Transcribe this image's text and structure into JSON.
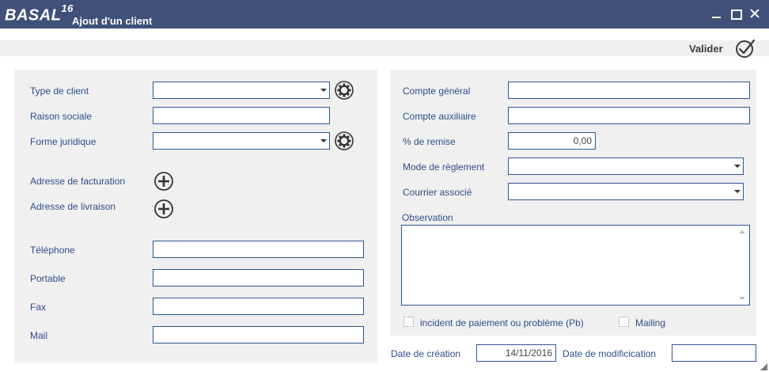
{
  "window": {
    "logo": "BASAL",
    "logo_version": "16",
    "title": "Ajout d'un client",
    "controls": [
      "minimize-icon",
      "maximize-icon",
      "close-icon"
    ]
  },
  "toolbar": {
    "validate_label": "Valider",
    "validate_icon": "check-circle-icon"
  },
  "left": {
    "client_type_label": "Type de client",
    "client_type_value": "",
    "company_name_label": "Raison sociale",
    "company_name_value": "",
    "legal_form_label": "Forme juridique",
    "legal_form_value": "",
    "billing_address_label": "Adresse de facturation",
    "delivery_address_label": "Adresse de livraison",
    "phone_label": "Téléphone",
    "phone_value": "",
    "mobile_label": "Portable",
    "mobile_value": "",
    "fax_label": "Fax",
    "fax_value": "",
    "mail_label": "Mail",
    "mail_value": ""
  },
  "right": {
    "general_account_label": "Compte général",
    "general_account_value": "",
    "aux_account_label": "Compte auxiliaire",
    "aux_account_value": "",
    "discount_label": "% de remise",
    "discount_value": "0,00",
    "payment_mode_label": "Mode de règlement",
    "payment_mode_value": "",
    "associated_mail_label": "Courrier associé",
    "associated_mail_value": "",
    "observation_label": "Observation",
    "observation_value": "",
    "incident_label": "incident de paiement ou problème (Pb)",
    "incident_checked": false,
    "mailing_label": "Mailing",
    "mailing_checked": false
  },
  "footer": {
    "creation_date_label": "Date de création",
    "creation_date_value": "14/11/2016",
    "modification_date_label": "Date de modificication",
    "modification_date_value": ""
  },
  "colors": {
    "titlebar": "#3f5178",
    "label": "#2e4d8a",
    "field_border": "#2b5796",
    "panel": "#f0f0f0"
  }
}
